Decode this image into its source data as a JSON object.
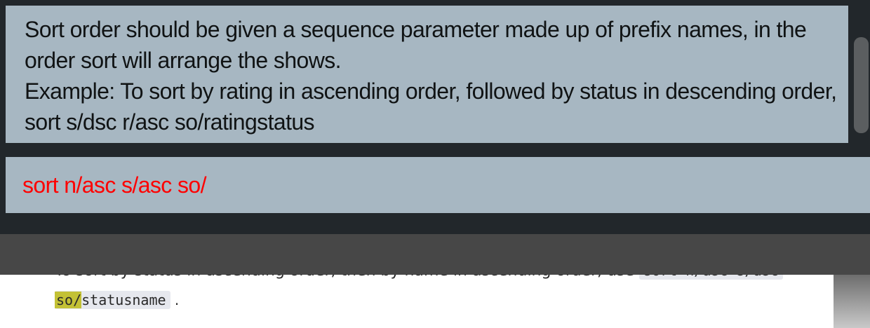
{
  "result_display": {
    "text": "Sort order should be given a sequence parameter made up of prefix names, in the order sort will arrange the shows.\nExample: To sort by rating in ascending order, followed by status in descending order, sort s/dsc r/asc so/ratingstatus"
  },
  "command_box": {
    "value": "sort n/asc s/asc so/",
    "text_color": "#ff0000"
  },
  "doc": {
    "line1_text": "To sort by status in ascending order, then by name in ascending order, use ",
    "line1_code": "sort n/asc s/asc",
    "line2_highlight": "so/",
    "line2_code": "statusname",
    "line2_end": "."
  },
  "colors": {
    "app_background": "#22272b",
    "panel_background": "#a7b7c2",
    "status_bar": "#474747",
    "highlight": "#c3c135"
  }
}
